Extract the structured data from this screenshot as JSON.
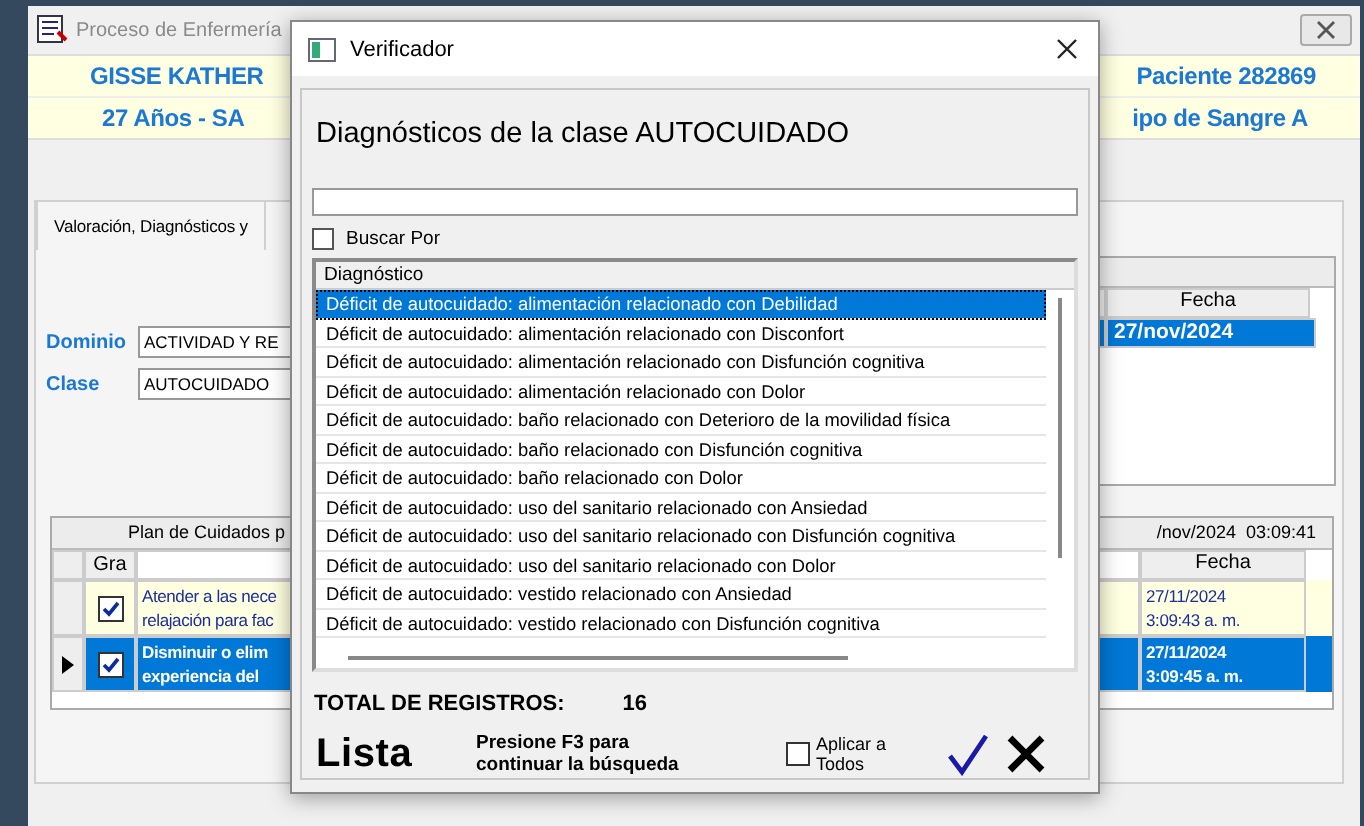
{
  "app_window": {
    "title": "Proceso de Enfermería",
    "patient": {
      "name": "GISSE KATHER",
      "id": "Paciente 282869",
      "age": "27 Años  -  SA",
      "blood": "ipo de Sangre A"
    },
    "tab": {
      "label": "Valoración, Diagnósticos y",
      "selected": true
    },
    "fields": [
      {
        "label": "Dominio",
        "value": "ACTIVIDAD  Y RE"
      },
      {
        "label": "Clase",
        "value": "AUTOCUIDADO"
      }
    ],
    "date_grid": {
      "columns": [
        "Fecha"
      ],
      "rows": [
        {
          "fecha": "27/nov/2024",
          "selected": true
        }
      ]
    },
    "care_plan": {
      "title": "Plan de Cuidados p",
      "timestamp": "/nov/2024  03:09:41",
      "columns": [
        "Gra",
        "Fecha"
      ],
      "rows": [
        {
          "checked": true,
          "selected": false,
          "text": [
            "Atender a las nece",
            "relajación para fac"
          ],
          "date": "27/11/2024",
          "time": "3:09:43 a. m."
        },
        {
          "checked": true,
          "selected": true,
          "text": [
            "Disminuir o elim",
            "experiencia del"
          ],
          "date": "27/11/2024",
          "time": "3:09:45 a. m."
        }
      ]
    }
  },
  "dialog": {
    "title": "Verificador",
    "heading": "Diagnósticos de la clase AUTOCUIDADO",
    "search_by": {
      "label": "Buscar Por",
      "checked": false
    },
    "list": {
      "header": "Diagnóstico",
      "items": [
        {
          "text": "Déficit de autocuidado: alimentación relacionado con Debilidad",
          "selected": true
        },
        {
          "text": "Déficit de autocuidado: alimentación relacionado con Disconfort",
          "selected": false
        },
        {
          "text": "Déficit de autocuidado: alimentación relacionado con Disfunción cognitiva",
          "selected": false
        },
        {
          "text": "Déficit de autocuidado: alimentación relacionado con Dolor",
          "selected": false
        },
        {
          "text": "Déficit de autocuidado: baño relacionado con Deterioro de la movilidad física",
          "selected": false
        },
        {
          "text": "Déficit de autocuidado: baño relacionado con Disfunción cognitiva",
          "selected": false
        },
        {
          "text": "Déficit de autocuidado: baño relacionado con Dolor",
          "selected": false
        },
        {
          "text": "Déficit de autocuidado: uso del sanitario relacionado con Ansiedad",
          "selected": false
        },
        {
          "text": "Déficit de autocuidado: uso del sanitario relacionado con Disfunción cognitiva",
          "selected": false
        },
        {
          "text": "Déficit de autocuidado: uso del sanitario relacionado con Dolor",
          "selected": false
        },
        {
          "text": "Déficit de autocuidado: vestido relacionado con Ansiedad",
          "selected": false
        },
        {
          "text": "Déficit de autocuidado: vestido relacionado con Disfunción cognitiva",
          "selected": false
        }
      ]
    },
    "total_label": "TOTAL DE REGISTROS:",
    "total": "16",
    "list_label": "Lista",
    "hint": "Presione F3 para continuar la búsqueda",
    "apply_all": {
      "label": "Aplicar a Todos",
      "checked": false
    }
  }
}
